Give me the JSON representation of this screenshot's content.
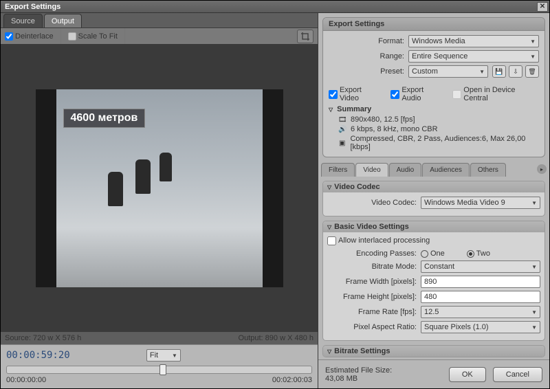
{
  "title": "Export Settings",
  "left": {
    "tabs": {
      "source": "Source",
      "output": "Output"
    },
    "deinterlace": "Deinterlace",
    "scale_to_fit": "Scale To Fit",
    "caption_text": "4600 метров",
    "source_dims": "Source: 720 w X 576 h",
    "output_dims": "Output: 890 w X 480 h",
    "timecode": "00:00:59:20",
    "fit": "Fit",
    "t_start": "00:00:00:00",
    "t_end": "00:02:00:03"
  },
  "export": {
    "heading": "Export Settings",
    "format_label": "Format:",
    "format_value": "Windows Media",
    "range_label": "Range:",
    "range_value": "Entire Sequence",
    "preset_label": "Preset:",
    "preset_value": "Custom",
    "export_video": "Export Video",
    "export_audio": "Export Audio",
    "open_device": "Open in Device Central",
    "summary_label": "Summary",
    "sum_video": "890x480, 12.5 [fps]",
    "sum_audio": "6 kbps,  8 kHz, mono CBR",
    "sum_comp": "Compressed, CBR, 2 Pass, Audiences:6, Max 26,00 [kbps]"
  },
  "tabs": {
    "filters": "Filters",
    "video": "Video",
    "audio": "Audio",
    "audiences": "Audiences",
    "others": "Others"
  },
  "video": {
    "codec_head": "Video Codec",
    "codec_label": "Video Codec:",
    "codec_value": "Windows Media Video 9",
    "basic_head": "Basic Video Settings",
    "interlaced": "Allow interlaced processing",
    "passes_label": "Encoding Passes:",
    "passes_one": "One",
    "passes_two": "Two",
    "bitrate_mode_label": "Bitrate Mode:",
    "bitrate_mode_value": "Constant",
    "width_label": "Frame Width [pixels]:",
    "width_value": "890",
    "height_label": "Frame Height [pixels]:",
    "height_value": "480",
    "fps_label": "Frame Rate [fps]:",
    "fps_value": "12.5",
    "par_label": "Pixel Aspect Ratio:",
    "par_value": "Square Pixels (1.0)",
    "bitrate_head": "Bitrate Settings"
  },
  "footer": {
    "est_label": "Estimated File Size:",
    "est_value": "43,08 MB",
    "ok": "OK",
    "cancel": "Cancel"
  }
}
